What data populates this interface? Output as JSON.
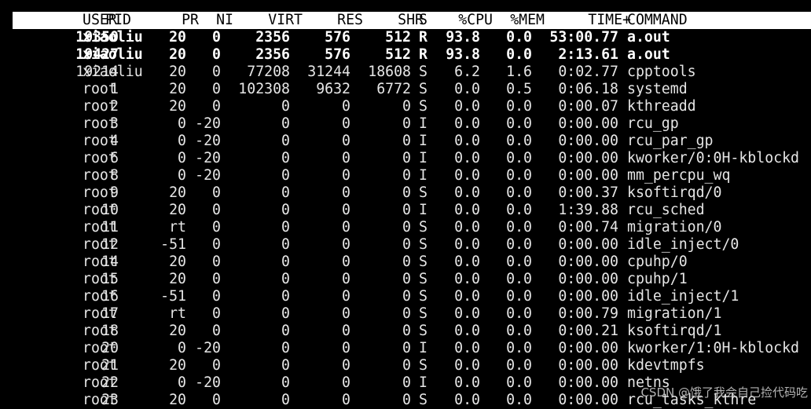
{
  "colors": {
    "background": "#000000",
    "text": "#e6e6e6",
    "header_bg": "#ffffff",
    "header_text": "#000000",
    "running_text": "#ffffff"
  },
  "header": {
    "pid": "PID",
    "user": "USER",
    "pr": "PR",
    "ni": "NI",
    "virt": "VIRT",
    "res": "RES",
    "shr": "SHR",
    "s": "S",
    "cpu": "%CPU",
    "mem": "%MEM",
    "time": "TIME+",
    "command": "COMMAND"
  },
  "processes": [
    {
      "pid": "19350",
      "user": "xiaoliu",
      "pr": "20",
      "ni": "0",
      "virt": "2356",
      "res": "576",
      "shr": "512",
      "s": "R",
      "cpu": "93.8",
      "mem": "0.0",
      "time": "53:00.77",
      "command": "a.out",
      "running": true
    },
    {
      "pid": "19427",
      "user": "xiaoliu",
      "pr": "20",
      "ni": "0",
      "virt": "2356",
      "res": "576",
      "shr": "512",
      "s": "R",
      "cpu": "93.8",
      "mem": "0.0",
      "time": "2:13.61",
      "command": "a.out",
      "running": true
    },
    {
      "pid": "19214",
      "user": "xiaoliu",
      "pr": "20",
      "ni": "0",
      "virt": "77208",
      "res": "31244",
      "shr": "18608",
      "s": "S",
      "cpu": "6.2",
      "mem": "1.6",
      "time": "0:02.77",
      "command": "cpptools",
      "running": false
    },
    {
      "pid": "1",
      "user": "root",
      "pr": "20",
      "ni": "0",
      "virt": "102308",
      "res": "9632",
      "shr": "6772",
      "s": "S",
      "cpu": "0.0",
      "mem": "0.5",
      "time": "0:06.18",
      "command": "systemd",
      "running": false
    },
    {
      "pid": "2",
      "user": "root",
      "pr": "20",
      "ni": "0",
      "virt": "0",
      "res": "0",
      "shr": "0",
      "s": "S",
      "cpu": "0.0",
      "mem": "0.0",
      "time": "0:00.07",
      "command": "kthreadd",
      "running": false
    },
    {
      "pid": "3",
      "user": "root",
      "pr": "0",
      "ni": "-20",
      "virt": "0",
      "res": "0",
      "shr": "0",
      "s": "I",
      "cpu": "0.0",
      "mem": "0.0",
      "time": "0:00.00",
      "command": "rcu_gp",
      "running": false
    },
    {
      "pid": "4",
      "user": "root",
      "pr": "0",
      "ni": "-20",
      "virt": "0",
      "res": "0",
      "shr": "0",
      "s": "I",
      "cpu": "0.0",
      "mem": "0.0",
      "time": "0:00.00",
      "command": "rcu_par_gp",
      "running": false
    },
    {
      "pid": "6",
      "user": "root",
      "pr": "0",
      "ni": "-20",
      "virt": "0",
      "res": "0",
      "shr": "0",
      "s": "I",
      "cpu": "0.0",
      "mem": "0.0",
      "time": "0:00.00",
      "command": "kworker/0:0H-kblockd",
      "running": false
    },
    {
      "pid": "8",
      "user": "root",
      "pr": "0",
      "ni": "-20",
      "virt": "0",
      "res": "0",
      "shr": "0",
      "s": "I",
      "cpu": "0.0",
      "mem": "0.0",
      "time": "0:00.00",
      "command": "mm_percpu_wq",
      "running": false
    },
    {
      "pid": "9",
      "user": "root",
      "pr": "20",
      "ni": "0",
      "virt": "0",
      "res": "0",
      "shr": "0",
      "s": "S",
      "cpu": "0.0",
      "mem": "0.0",
      "time": "0:00.37",
      "command": "ksoftirqd/0",
      "running": false
    },
    {
      "pid": "10",
      "user": "root",
      "pr": "20",
      "ni": "0",
      "virt": "0",
      "res": "0",
      "shr": "0",
      "s": "I",
      "cpu": "0.0",
      "mem": "0.0",
      "time": "1:39.88",
      "command": "rcu_sched",
      "running": false
    },
    {
      "pid": "11",
      "user": "root",
      "pr": "rt",
      "ni": "0",
      "virt": "0",
      "res": "0",
      "shr": "0",
      "s": "S",
      "cpu": "0.0",
      "mem": "0.0",
      "time": "0:00.74",
      "command": "migration/0",
      "running": false
    },
    {
      "pid": "12",
      "user": "root",
      "pr": "-51",
      "ni": "0",
      "virt": "0",
      "res": "0",
      "shr": "0",
      "s": "S",
      "cpu": "0.0",
      "mem": "0.0",
      "time": "0:00.00",
      "command": "idle_inject/0",
      "running": false
    },
    {
      "pid": "14",
      "user": "root",
      "pr": "20",
      "ni": "0",
      "virt": "0",
      "res": "0",
      "shr": "0",
      "s": "S",
      "cpu": "0.0",
      "mem": "0.0",
      "time": "0:00.00",
      "command": "cpuhp/0",
      "running": false
    },
    {
      "pid": "15",
      "user": "root",
      "pr": "20",
      "ni": "0",
      "virt": "0",
      "res": "0",
      "shr": "0",
      "s": "S",
      "cpu": "0.0",
      "mem": "0.0",
      "time": "0:00.00",
      "command": "cpuhp/1",
      "running": false
    },
    {
      "pid": "16",
      "user": "root",
      "pr": "-51",
      "ni": "0",
      "virt": "0",
      "res": "0",
      "shr": "0",
      "s": "S",
      "cpu": "0.0",
      "mem": "0.0",
      "time": "0:00.00",
      "command": "idle_inject/1",
      "running": false
    },
    {
      "pid": "17",
      "user": "root",
      "pr": "rt",
      "ni": "0",
      "virt": "0",
      "res": "0",
      "shr": "0",
      "s": "S",
      "cpu": "0.0",
      "mem": "0.0",
      "time": "0:00.79",
      "command": "migration/1",
      "running": false
    },
    {
      "pid": "18",
      "user": "root",
      "pr": "20",
      "ni": "0",
      "virt": "0",
      "res": "0",
      "shr": "0",
      "s": "S",
      "cpu": "0.0",
      "mem": "0.0",
      "time": "0:00.21",
      "command": "ksoftirqd/1",
      "running": false
    },
    {
      "pid": "20",
      "user": "root",
      "pr": "0",
      "ni": "-20",
      "virt": "0",
      "res": "0",
      "shr": "0",
      "s": "I",
      "cpu": "0.0",
      "mem": "0.0",
      "time": "0:00.00",
      "command": "kworker/1:0H-kblockd",
      "running": false
    },
    {
      "pid": "21",
      "user": "root",
      "pr": "20",
      "ni": "0",
      "virt": "0",
      "res": "0",
      "shr": "0",
      "s": "S",
      "cpu": "0.0",
      "mem": "0.0",
      "time": "0:00.00",
      "command": "kdevtmpfs",
      "running": false
    },
    {
      "pid": "22",
      "user": "root",
      "pr": "0",
      "ni": "-20",
      "virt": "0",
      "res": "0",
      "shr": "0",
      "s": "I",
      "cpu": "0.0",
      "mem": "0.0",
      "time": "0:00.00",
      "command": "netns",
      "running": false
    },
    {
      "pid": "23",
      "user": "root",
      "pr": "20",
      "ni": "0",
      "virt": "0",
      "res": "0",
      "shr": "0",
      "s": "S",
      "cpu": "0.0",
      "mem": "0.0",
      "time": "0:00.00",
      "command": "rcu_tasks_kthre",
      "running": false
    }
  ],
  "watermark": "CSDN @饿了我会自己捡代码吃"
}
